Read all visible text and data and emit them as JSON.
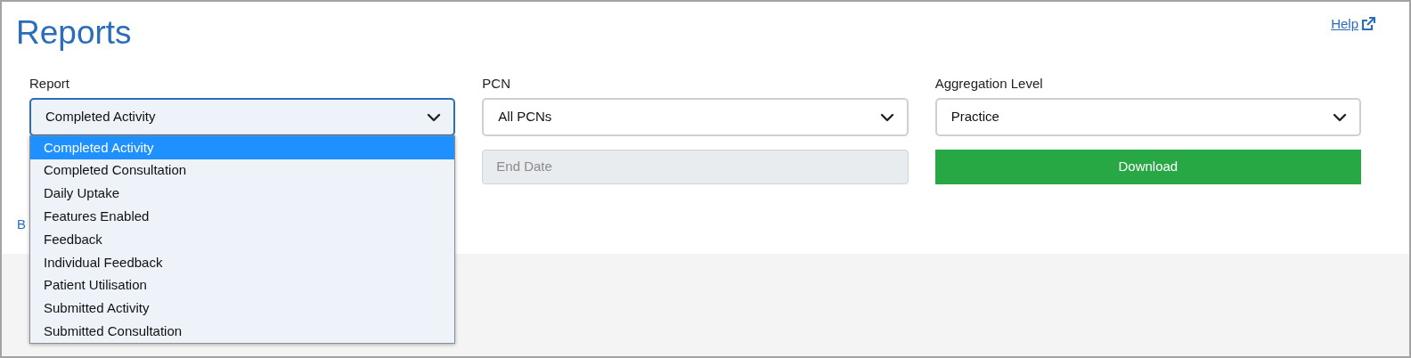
{
  "page": {
    "title": "Reports",
    "help_link": "Help"
  },
  "filters": [
    {
      "label": "Report",
      "value": "Completed Activity",
      "expanded": true
    },
    {
      "label": "PCN",
      "value": "All PCNs",
      "expanded": false
    },
    {
      "label": "Aggregation Level",
      "value": "Practice",
      "expanded": false
    }
  ],
  "end_date": {
    "placeholder": "End Date",
    "disabled": true
  },
  "download_button": "Download",
  "back_link": "B",
  "report_options": [
    {
      "label": "Completed Activity",
      "selected": true
    },
    {
      "label": "Completed Consultation",
      "selected": false
    },
    {
      "label": "Daily Uptake",
      "selected": false
    },
    {
      "label": "Features Enabled",
      "selected": false
    },
    {
      "label": "Feedback",
      "selected": false
    },
    {
      "label": "Individual Feedback",
      "selected": false
    },
    {
      "label": "Patient Utilisation",
      "selected": false
    },
    {
      "label": "Submitted Activity",
      "selected": false
    },
    {
      "label": "Submitted Consultation",
      "selected": false
    }
  ]
}
